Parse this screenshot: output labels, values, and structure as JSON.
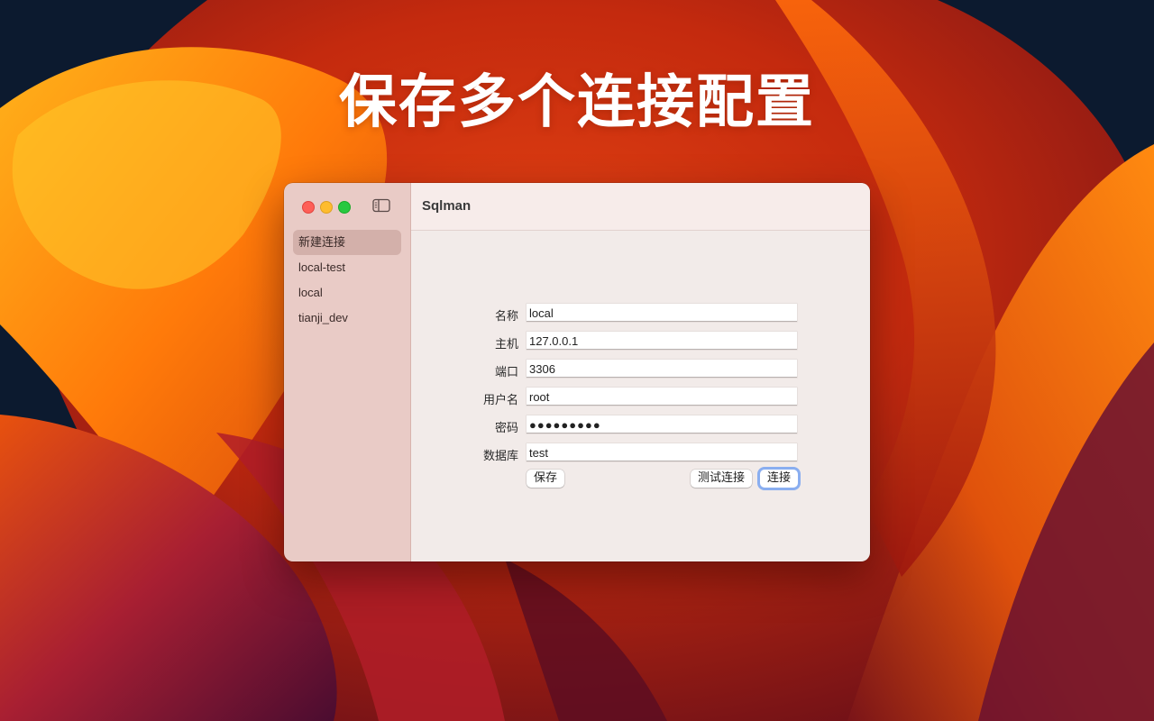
{
  "headline": "保存多个连接配置",
  "window": {
    "title": "Sqlman"
  },
  "sidebar": {
    "items": [
      {
        "label": "新建连接",
        "selected": true
      },
      {
        "label": "local-test",
        "selected": false
      },
      {
        "label": "local",
        "selected": false
      },
      {
        "label": "tianji_dev",
        "selected": false
      }
    ]
  },
  "form": {
    "name_label": "名称",
    "name_value": "local",
    "host_label": "主机",
    "host_value": "127.0.0.1",
    "port_label": "端口",
    "port_value": "3306",
    "user_label": "用户名",
    "user_value": "root",
    "password_label": "密码",
    "password_value": "●●●●●●●●●",
    "database_label": "数据库",
    "database_value": "test"
  },
  "buttons": {
    "save": "保存",
    "test_connection": "测试连接",
    "connect": "连接"
  },
  "colors": {
    "traffic_close": "#fe5f57",
    "traffic_minimize": "#febc2e",
    "traffic_maximize": "#28c840",
    "focus_ring": "#8aaef0"
  },
  "icons": {
    "sidebar_toggle": "sidebar-toggle-icon"
  }
}
